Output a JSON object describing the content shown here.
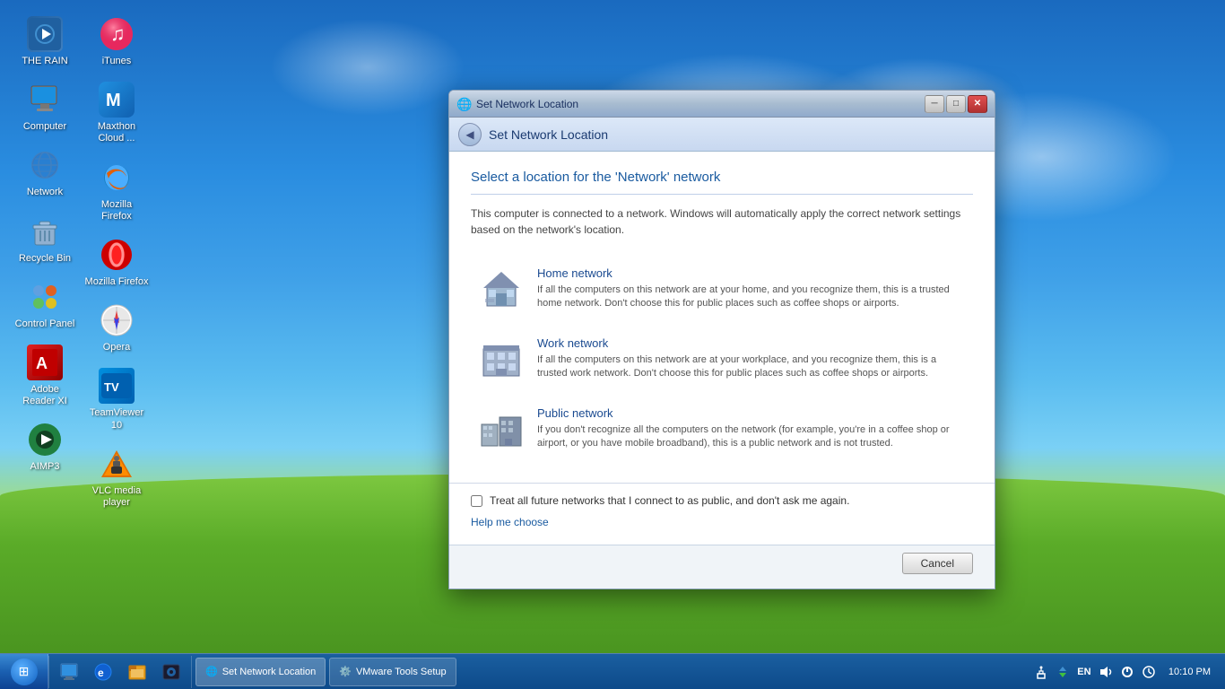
{
  "desktop": {
    "background": "windows7-nature"
  },
  "desktop_icons_col1": [
    {
      "id": "the-rain",
      "label": "THE RAIN",
      "icon": "🎵",
      "iconStyle": "the-rain"
    },
    {
      "id": "computer",
      "label": "Computer",
      "icon": "🖥️",
      "iconStyle": "computer"
    },
    {
      "id": "network",
      "label": "Network",
      "icon": "🌐",
      "iconStyle": "network"
    },
    {
      "id": "recycle-bin",
      "label": "Recycle Bin",
      "icon": "🗑️",
      "iconStyle": "recycle"
    },
    {
      "id": "control-panel",
      "label": "Control Panel",
      "icon": "⚙️",
      "iconStyle": "control-panel"
    },
    {
      "id": "adobe-reader",
      "label": "Adobe\nReader XI",
      "icon": "📄",
      "iconStyle": "adobe"
    },
    {
      "id": "aimp",
      "label": "AIMP3",
      "icon": "♪",
      "iconStyle": "aimp"
    }
  ],
  "desktop_icons_col2": [
    {
      "id": "itunes",
      "label": "iTunes",
      "icon": "♫",
      "iconStyle": "itunes"
    },
    {
      "id": "maxthon",
      "label": "Maxthon\nCloud ...",
      "icon": "M",
      "iconStyle": "maxthon"
    },
    {
      "id": "firefox",
      "label": "Mozilla\nFirefox",
      "icon": "🦊",
      "iconStyle": "firefox"
    },
    {
      "id": "opera",
      "label": "Opera",
      "icon": "O",
      "iconStyle": "opera"
    },
    {
      "id": "safari",
      "label": "Safari",
      "icon": "🧭",
      "iconStyle": "safari"
    },
    {
      "id": "teamviewer",
      "label": "TeamViewer\n10",
      "icon": "TV",
      "iconStyle": "teamviewer"
    },
    {
      "id": "vlc",
      "label": "VLC media\nplayer",
      "icon": "🔶",
      "iconStyle": "vlc"
    }
  ],
  "dialog": {
    "title": "Set Network Location",
    "subtitle": "Select a location for the 'Network' network",
    "description": "This computer is connected to a network. Windows will automatically apply the correct network settings based on the network's location.",
    "options": [
      {
        "id": "home-network",
        "title": "Home network",
        "description": "If all the computers on this network are at your home, and you recognize them, this is a trusted home network.  Don't choose this for public places such as coffee shops or airports.",
        "icon": "🏠"
      },
      {
        "id": "work-network",
        "title": "Work network",
        "description": "If all the computers on this network are at your workplace, and you recognize them, this is a trusted work network.  Don't choose this for public places such as coffee shops or airports.",
        "icon": "🏢"
      },
      {
        "id": "public-network",
        "title": "Public network",
        "description": "If you don't recognize all the computers on the network (for example, you're in a coffee shop or airport, or you have mobile broadband), this is a public network and is not trusted.",
        "icon": "🏙️"
      }
    ],
    "checkbox_label": "Treat all future networks that I connect to as public, and don't ask me again.",
    "help_link": "Help me choose",
    "cancel_button": "Cancel",
    "controls": {
      "minimize": "─",
      "maximize": "□",
      "close": "✕"
    }
  },
  "taskbar": {
    "start_icon": "⊞",
    "buttons": [
      {
        "id": "set-network",
        "label": "Set Network Location",
        "active": true
      },
      {
        "id": "vmware-tools",
        "label": "VMware Tools Setup",
        "active": false
      }
    ],
    "clock": "10:10 PM",
    "tray_icons": [
      "🌐",
      "🔊",
      "📶",
      "🔋"
    ]
  }
}
